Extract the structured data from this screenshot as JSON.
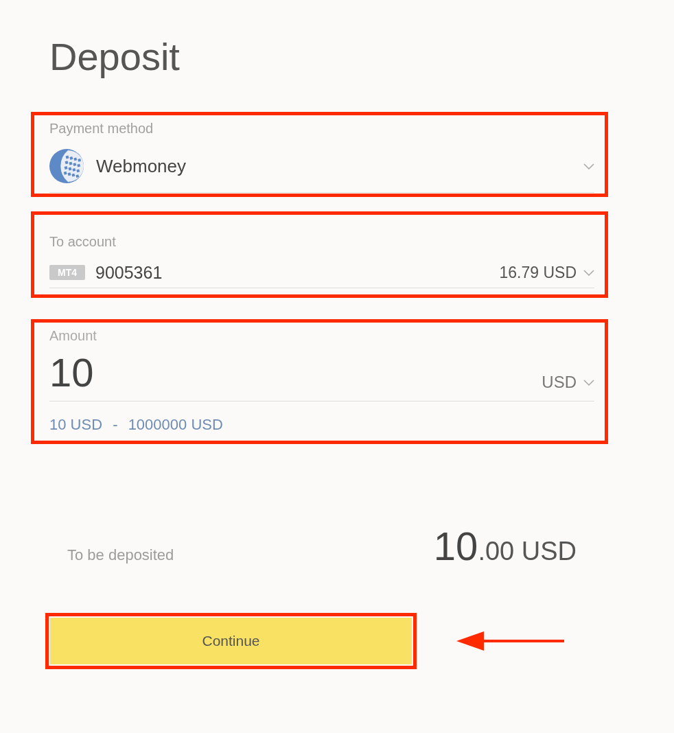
{
  "title": "Deposit",
  "payment_method": {
    "label": "Payment method",
    "value": "Webmoney",
    "highlighted": true
  },
  "to_account": {
    "label": "To account",
    "platform": "MT4",
    "account_number": "9005361",
    "balance": "16.79 USD",
    "highlighted": true
  },
  "amount": {
    "label": "Amount",
    "value": "10",
    "currency": "USD",
    "range": {
      "min": "10 USD",
      "separator": "-",
      "max": "1000000 USD"
    },
    "highlighted": true
  },
  "to_be_deposited": {
    "label": "To be deposited",
    "integer": "10",
    "decimals": ".00",
    "currency": "USD"
  },
  "continue_button": {
    "label": "Continue",
    "highlighted": true,
    "pointer_arrow": true
  }
}
